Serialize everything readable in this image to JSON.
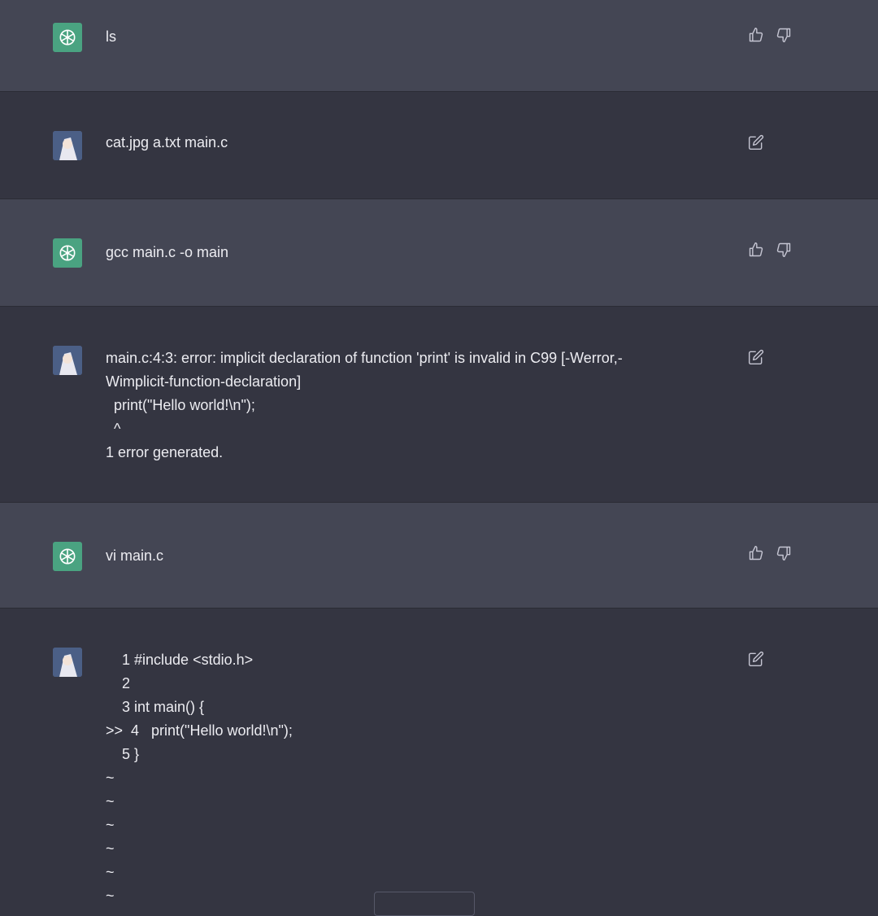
{
  "messages": [
    {
      "role": "assistant",
      "text": "ls"
    },
    {
      "role": "user",
      "text": "cat.jpg a.txt main.c"
    },
    {
      "role": "assistant",
      "text": "gcc main.c -o main"
    },
    {
      "role": "user",
      "text": "main.c:4:3: error: implicit declaration of function 'print' is invalid in C99 [-Werror,-\nWimplicit-function-declaration]\n  print(\"Hello world!\\n\");\n  ^\n1 error generated."
    },
    {
      "role": "assistant",
      "text": "vi main.c"
    },
    {
      "role": "user",
      "text": "    1 #include <stdio.h>\n    2\n    3 int main() {\n>>  4   print(\"Hello world!\\n\");\n    5 }\n~\n~\n~\n~\n~\n~"
    }
  ],
  "icons": {
    "assistant_avatar": "openai-logo-icon",
    "user_avatar": "anime-avatar-icon",
    "like": "thumbs-up-icon",
    "dislike": "thumbs-down-icon",
    "edit": "edit-icon"
  },
  "colors": {
    "assistant_bg": "#444654",
    "user_bg": "#343541",
    "logo_green": "#4aa381"
  }
}
